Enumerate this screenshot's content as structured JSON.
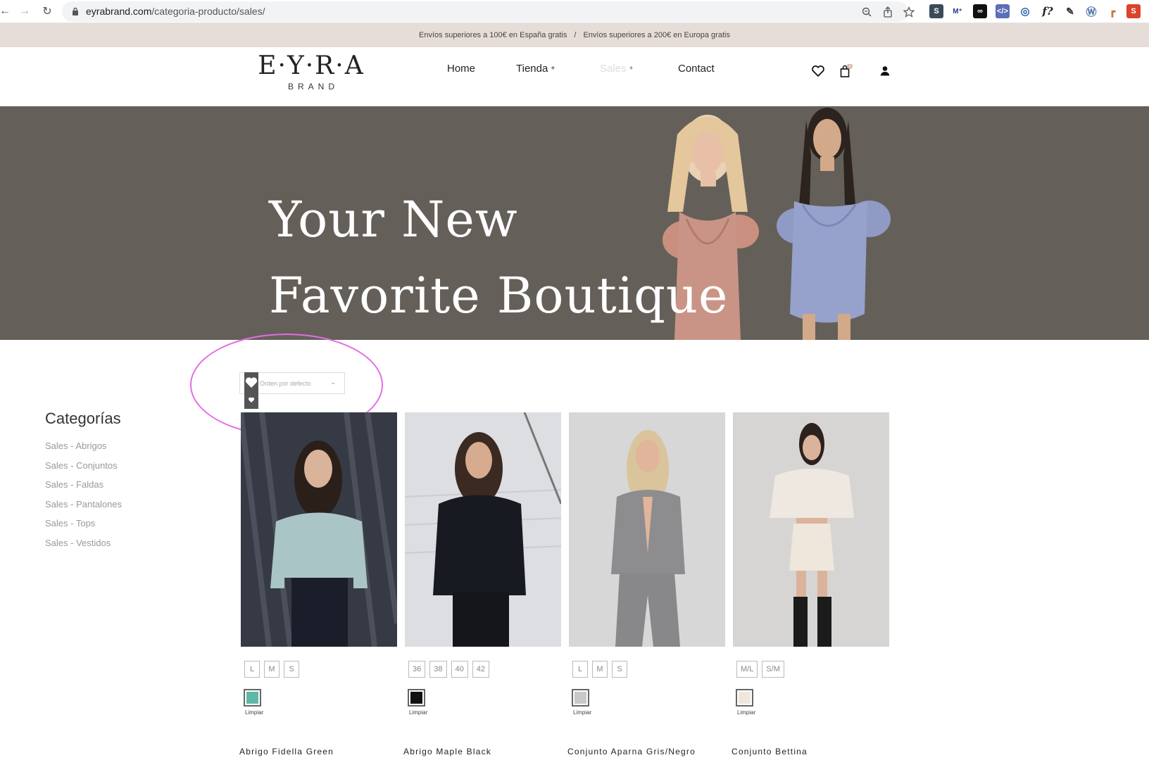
{
  "browser": {
    "url_domain": "eyrabrand.com",
    "url_path": "/categoria-producto/sales/"
  },
  "promo": {
    "left": "Envíos superiores a 100€ en España gratis",
    "separator": "/",
    "right": "Envíos superiores a 200€ en Europa gratis"
  },
  "logo": {
    "main": "E·Y·R·A",
    "sub": "BRAND"
  },
  "menu": {
    "home": "Home",
    "tienda": "Tienda",
    "sales": "Sales",
    "contact": "Contact",
    "plus": "+"
  },
  "cart_count": "0",
  "hero": {
    "line1": "Your New",
    "line2": "Favorite Boutique"
  },
  "sorting": {
    "placeholder": "Orden por defecto"
  },
  "sidebar": {
    "title": "Categorías",
    "items": [
      "Sales - Abrigos",
      "Sales - Conjuntos",
      "Sales - Faldas",
      "Sales - Pantalones",
      "Sales - Tops",
      "Sales - Vestidos"
    ]
  },
  "products": [
    {
      "name": "Abrigo Fidella Green",
      "sizes": [
        "L",
        "M",
        "S"
      ],
      "color": "#5fb8a6",
      "clear": "Limpiar"
    },
    {
      "name": "Abrigo Maple Black",
      "sizes": [
        "36",
        "38",
        "40",
        "42"
      ],
      "color": "#111111",
      "clear": "Limpiar"
    },
    {
      "name": "Conjunto Aparna Gris/Negro",
      "sizes": [
        "L",
        "M",
        "S"
      ],
      "color": "#c8c8c8",
      "clear": "Limpiar"
    },
    {
      "name": "Conjunto Bettina",
      "sizes": [
        "M/L",
        "S/M"
      ],
      "color": "#efe7dd",
      "clear": "Limpiar"
    }
  ],
  "colors": {
    "promo_bg": "#e7ddd8",
    "hero_bg": "#646059",
    "highlight": "#e46be6"
  }
}
